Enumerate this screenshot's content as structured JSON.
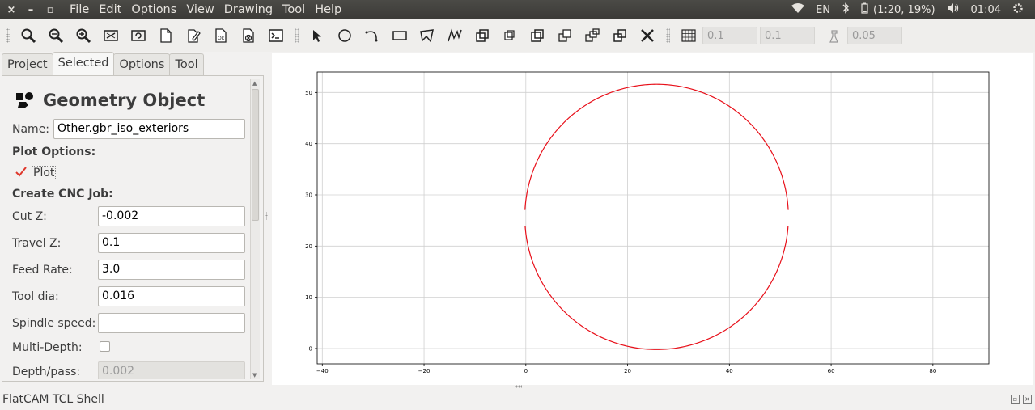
{
  "menubar": {
    "window_buttons": [
      "×",
      "–",
      "▫"
    ],
    "items": [
      "File",
      "Edit",
      "Options",
      "View",
      "Drawing",
      "Tool",
      "Help"
    ],
    "tray": {
      "language": "EN",
      "battery": "(1:20, 19%)",
      "clock": "01:04"
    }
  },
  "toolbar": {
    "grid_x": "0.1",
    "grid_y": "0.1",
    "snap_max": "0.05"
  },
  "tabs": [
    "Project",
    "Selected",
    "Options",
    "Tool"
  ],
  "panel": {
    "title": "Geometry Object",
    "name_label": "Name:",
    "name_value": "Other.gbr_iso_exteriors",
    "plot_options": "Plot Options:",
    "plot_label": "Plot",
    "cnc_header": "Create CNC Job:",
    "fields": [
      {
        "label": "Cut Z:",
        "value": "-0.002"
      },
      {
        "label": "Travel Z:",
        "value": "0.1"
      },
      {
        "label": "Feed Rate:",
        "value": "3.0"
      },
      {
        "label": "Tool dia:",
        "value": "0.016"
      },
      {
        "label": "Spindle speed:",
        "value": ""
      }
    ],
    "multi_depth_label": "Multi-Depth:",
    "depth_pass_label": "Depth/pass:",
    "depth_pass_value": "0.002"
  },
  "chart_data": {
    "type": "line",
    "xlim": [
      -41,
      91
    ],
    "ylim": [
      -3,
      54
    ],
    "x_ticks": [
      -40,
      -20,
      0,
      20,
      40,
      60,
      80
    ],
    "y_ticks": [
      0,
      10,
      20,
      30,
      40,
      50
    ],
    "grid": true,
    "series": [
      {
        "color": "#e8101a",
        "shape": "circle",
        "center": [
          25.7,
          25.7
        ],
        "radius": 25.9,
        "gap_y_range": [
          24.2,
          26.9
        ]
      }
    ]
  },
  "shell": {
    "title": "FlatCAM TCL Shell"
  }
}
